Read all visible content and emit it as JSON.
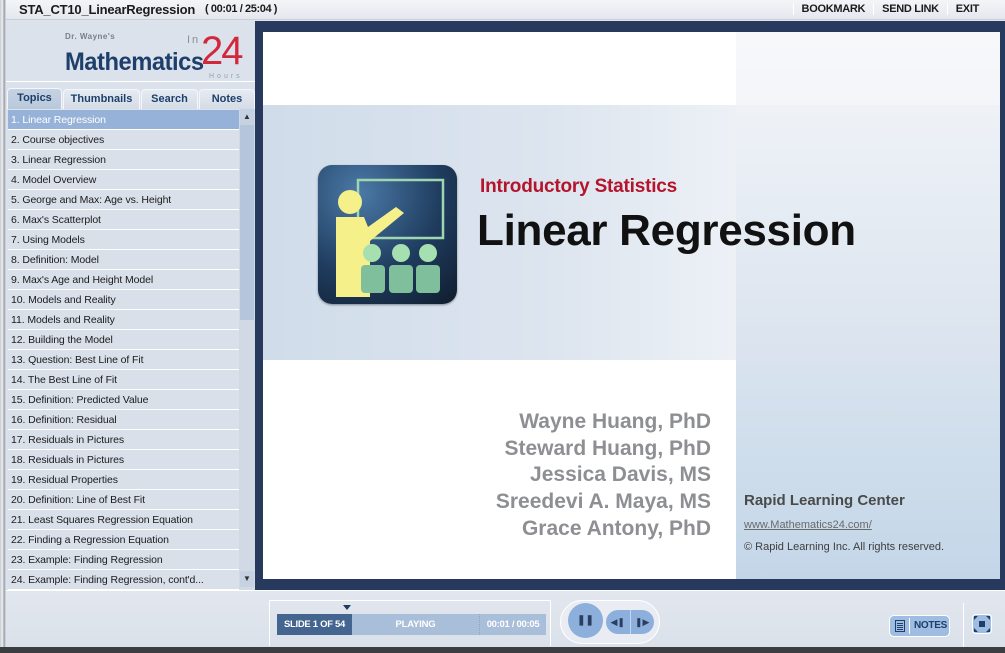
{
  "titlebar": {
    "title": "STA_CT10_LinearRegression",
    "time": "( 00:01 / 25:04 )",
    "links": [
      "BOOKMARK",
      "SEND LINK",
      "EXIT"
    ]
  },
  "logo": {
    "author": "Dr. Wayne's",
    "subject": "Mathematics",
    "in": "In",
    "number": "24",
    "hours": "Hours"
  },
  "tabs": [
    "Topics",
    "Thumbnails",
    "Search",
    "Notes"
  ],
  "active_tab": "Topics",
  "topics": [
    "1. Linear Regression",
    "2. Course objectives",
    "3. Linear Regression",
    "4. Model Overview",
    "5. George and Max: Age vs. Height",
    "6. Max's Scatterplot",
    "7. Using Models",
    "8. Definition: Model",
    "9. Max's Age and Height Model",
    "10. Models and Reality",
    "11. Models and Reality",
    "12. Building the Model",
    "13. Question: Best Line of Fit",
    "14. The Best Line of Fit",
    "15. Definition: Predicted Value",
    "16. Definition: Residual",
    "17. Residuals in Pictures",
    "18. Residuals in Pictures",
    "19. Residual Properties",
    "20. Definition: Line of Best Fit",
    "21. Least Squares Regression Equation",
    "22. Finding a Regression Equation",
    "23. Example: Finding Regression",
    "24. Example: Finding Regression, cont'd..."
  ],
  "active_topic_index": 0,
  "scrollbar": {
    "up_icon": "▲",
    "down_icon": "▼"
  },
  "slide": {
    "subtitle": "Introductory Statistics",
    "title": "Linear Regression",
    "icon": "teacher-classroom-icon",
    "authors": [
      "Wayne Huang, PhD",
      "Steward Huang, PhD",
      "Jessica Davis, MS",
      "Sreedevi A. Maya, MS",
      "Grace Antony, PhD"
    ],
    "organization": "Rapid Learning Center",
    "url": "www.Mathematics24.com/",
    "copyright": "© Rapid Learning Inc. All rights reserved.",
    "accent_color": "#b5152b"
  },
  "player": {
    "slide_label": "SLIDE 1 OF 54",
    "status": "PLAYING",
    "clock": "00:01 / 00:05",
    "pause_icon": "❚❚",
    "prev_icon": "◀❚",
    "next_icon": "❚▶",
    "notes_label": "NOTES"
  }
}
